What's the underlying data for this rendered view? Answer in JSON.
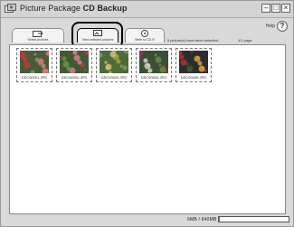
{
  "window": {
    "title_prefix": "Picture Package",
    "title_bold": "CD Backup",
    "minimize": "–",
    "maximize": "□",
    "close": "×"
  },
  "help": {
    "label": "Help",
    "icon": "?"
  },
  "steps": [
    {
      "label": "Select pictures",
      "icon": "folder-arrow-icon"
    },
    {
      "label": "View selected pictures",
      "icon": "monitor-view-icon",
      "active": true
    },
    {
      "label": "Write to CD-R",
      "icon": "cd-disc-icon"
    }
  ],
  "status_text": "5 picture(s) have been selected.",
  "page_count": "1/1 page",
  "thumbnails": [
    {
      "filename": "DSC00001.JPG",
      "scene": "flowers"
    },
    {
      "filename": "DSC00002.JPG",
      "scene": "flowers"
    },
    {
      "filename": "DSC00003.JPG",
      "scene": "flowers"
    },
    {
      "filename": "DSC00004.JPG",
      "scene": "flowers"
    },
    {
      "filename": "DSC00005.JPG",
      "scene": "flowers"
    }
  ],
  "capacity": {
    "text": "6MB / 640MB",
    "used_fraction": 0.01
  },
  "colors": {
    "highlight": "#000000",
    "background": "#d9d9d9",
    "content": "#ffffff"
  }
}
